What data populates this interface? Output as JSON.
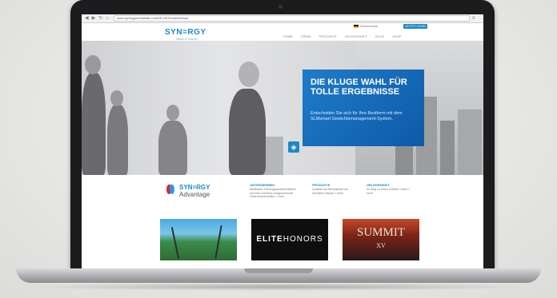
{
  "browser": {
    "nav_icons": [
      "back-icon",
      "forward-icon",
      "reload-icon",
      "home-icon"
    ],
    "url": "www.synergyworldwide.com/DE-DE/Home/Default"
  },
  "site": {
    "logo": "SYN=RGY",
    "logo_sub": "Nature & Science",
    "language": "Deutschland",
    "login": "JETZT LOGIN",
    "nav": [
      "HOME",
      "FIRMA",
      "PRODUKTE",
      "GELEGENHEIT",
      "BLOG",
      "SHOP"
    ]
  },
  "hero": {
    "headline": "DIE KLUGE WAHL FÜR TOLLE ERGEBNISSE",
    "text": "Entscheiden Sie sich für Ihre Bestform mit dem SLMsmart Gewichtsmanagement-System.",
    "accent": "#1e7cc9"
  },
  "info": {
    "brand_line1": "SYN=RGY",
    "brand_line2": "Advantage",
    "columns": [
      {
        "title": "UNTERNEHMEN",
        "text": "Weltklasse Führungspersönlichkeiten und eine mehrfach ausgezeichnete Unternehmenskultur » mehr"
      },
      {
        "title": "PRODUKTE",
        "text": "Qualität und Wirksamkeit auf höchstem Niveau » mehr"
      },
      {
        "title": "GELEGENHEIT",
        "text": "Ihr Weg zu einem erfüllten Leben » mehr"
      }
    ]
  },
  "tiles": {
    "elite": {
      "bold": "ELITE",
      "rest": "HONORS"
    },
    "summit": {
      "main": "SUMMIT",
      "sub": "XV"
    }
  }
}
